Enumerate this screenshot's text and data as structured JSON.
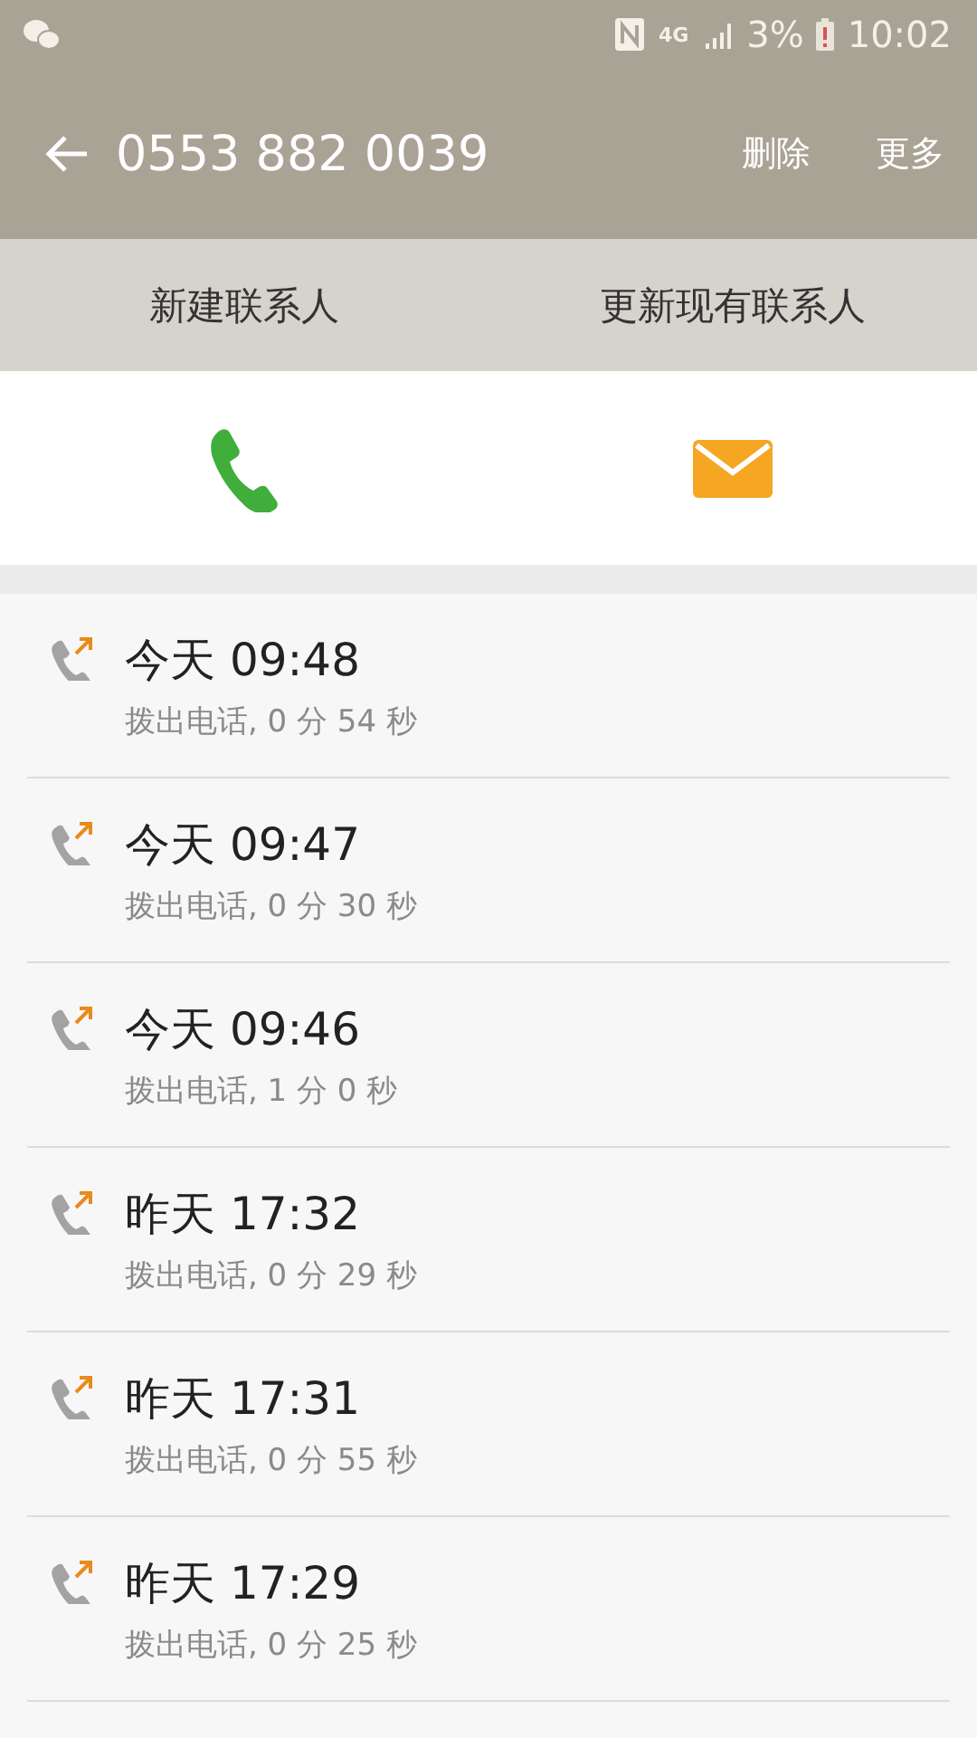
{
  "status_bar": {
    "network": "4G",
    "battery": "3%",
    "time": "10:02"
  },
  "header": {
    "title": "0553 882 0039",
    "actions": [
      "删除",
      "更多"
    ]
  },
  "action_bar": {
    "buttons": [
      "新建联系人",
      "更新现有联系人"
    ]
  },
  "calls": [
    {
      "kind": "outgoing",
      "time": "今天 09:48",
      "detail": "拨出电话, 0 分 54 秒"
    },
    {
      "kind": "outgoing",
      "time": "今天 09:47",
      "detail": "拨出电话, 0 分 30 秒"
    },
    {
      "kind": "outgoing",
      "time": "今天 09:46",
      "detail": "拨出电话, 1 分 0 秒"
    },
    {
      "kind": "outgoing",
      "time": "昨天 17:32",
      "detail": "拨出电话, 0 分 29 秒"
    },
    {
      "kind": "outgoing",
      "time": "昨天 17:31",
      "detail": "拨出电话, 0 分 55 秒"
    },
    {
      "kind": "outgoing",
      "time": "昨天 17:29",
      "detail": "拨出电话, 0 分 25 秒"
    }
  ]
}
